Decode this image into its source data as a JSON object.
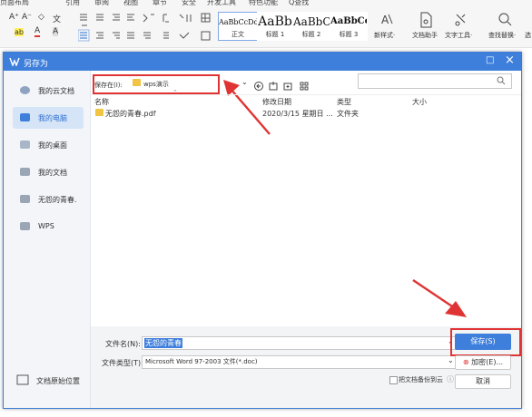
{
  "ribbon": {
    "menu": [
      "页面布局",
      "引用",
      "审阅",
      "视图",
      "章节",
      "安全",
      "开发工具",
      "特色功能",
      "Q查找"
    ],
    "font_grow": "A⁺",
    "font_shrink": "A⁻",
    "clear_format": "◇",
    "phonetic": "文",
    "highlight": "ab",
    "font_color": "A",
    "char_shade": "A",
    "styles": [
      {
        "preview": "AaBbCcDd",
        "label": "正文"
      },
      {
        "preview": "AaBb",
        "label": "标题 1"
      },
      {
        "preview": "AaBbC",
        "label": "标题 2"
      },
      {
        "preview": "AaBbCcI",
        "label": "标题 3"
      }
    ],
    "new_style": "新样式·",
    "doc_helper": "文档助手",
    "text_tools": "文字工具·",
    "find_replace": "查找替换·",
    "select_cut": "选"
  },
  "dialog": {
    "title": "另存为",
    "maximize": "□",
    "close": "×",
    "sidebar": [
      {
        "label": "我的云文档",
        "icon": "cloud-icon"
      },
      {
        "label": "我的电脑",
        "icon": "computer-icon"
      },
      {
        "label": "我的桌面",
        "icon": "desktop-icon"
      },
      {
        "label": "我的文档",
        "icon": "folder-icon"
      },
      {
        "label": "无怨的青春.",
        "icon": "folder-icon"
      },
      {
        "label": "WPS",
        "icon": "folder-icon"
      }
    ],
    "original_location": "文档原始位置",
    "save_in_label": "保存在(I):",
    "save_in_value": "wps演示",
    "columns": {
      "name": "名称",
      "modified": "修改日期",
      "type": "类型",
      "size": "大小"
    },
    "files": [
      {
        "name": "无怨的青春.pdf",
        "modified": "2020/3/15 星期日 ...",
        "type": "文件夹",
        "size": ""
      }
    ],
    "filename_label": "文件名(N):",
    "filename_value": "无怨的青春",
    "filetype_label": "文件类型(T):",
    "filetype_value": "Microsoft Word 97-2003 文件(*.doc)",
    "save_button": "保存(S)",
    "encrypt_button": "加密(E)...",
    "backup_label": "把文档备份到云",
    "cancel_button": "取消"
  },
  "colors": {
    "accent": "#3f7fdc",
    "highlight_red": "#e03434",
    "folder": "#f2c443"
  }
}
